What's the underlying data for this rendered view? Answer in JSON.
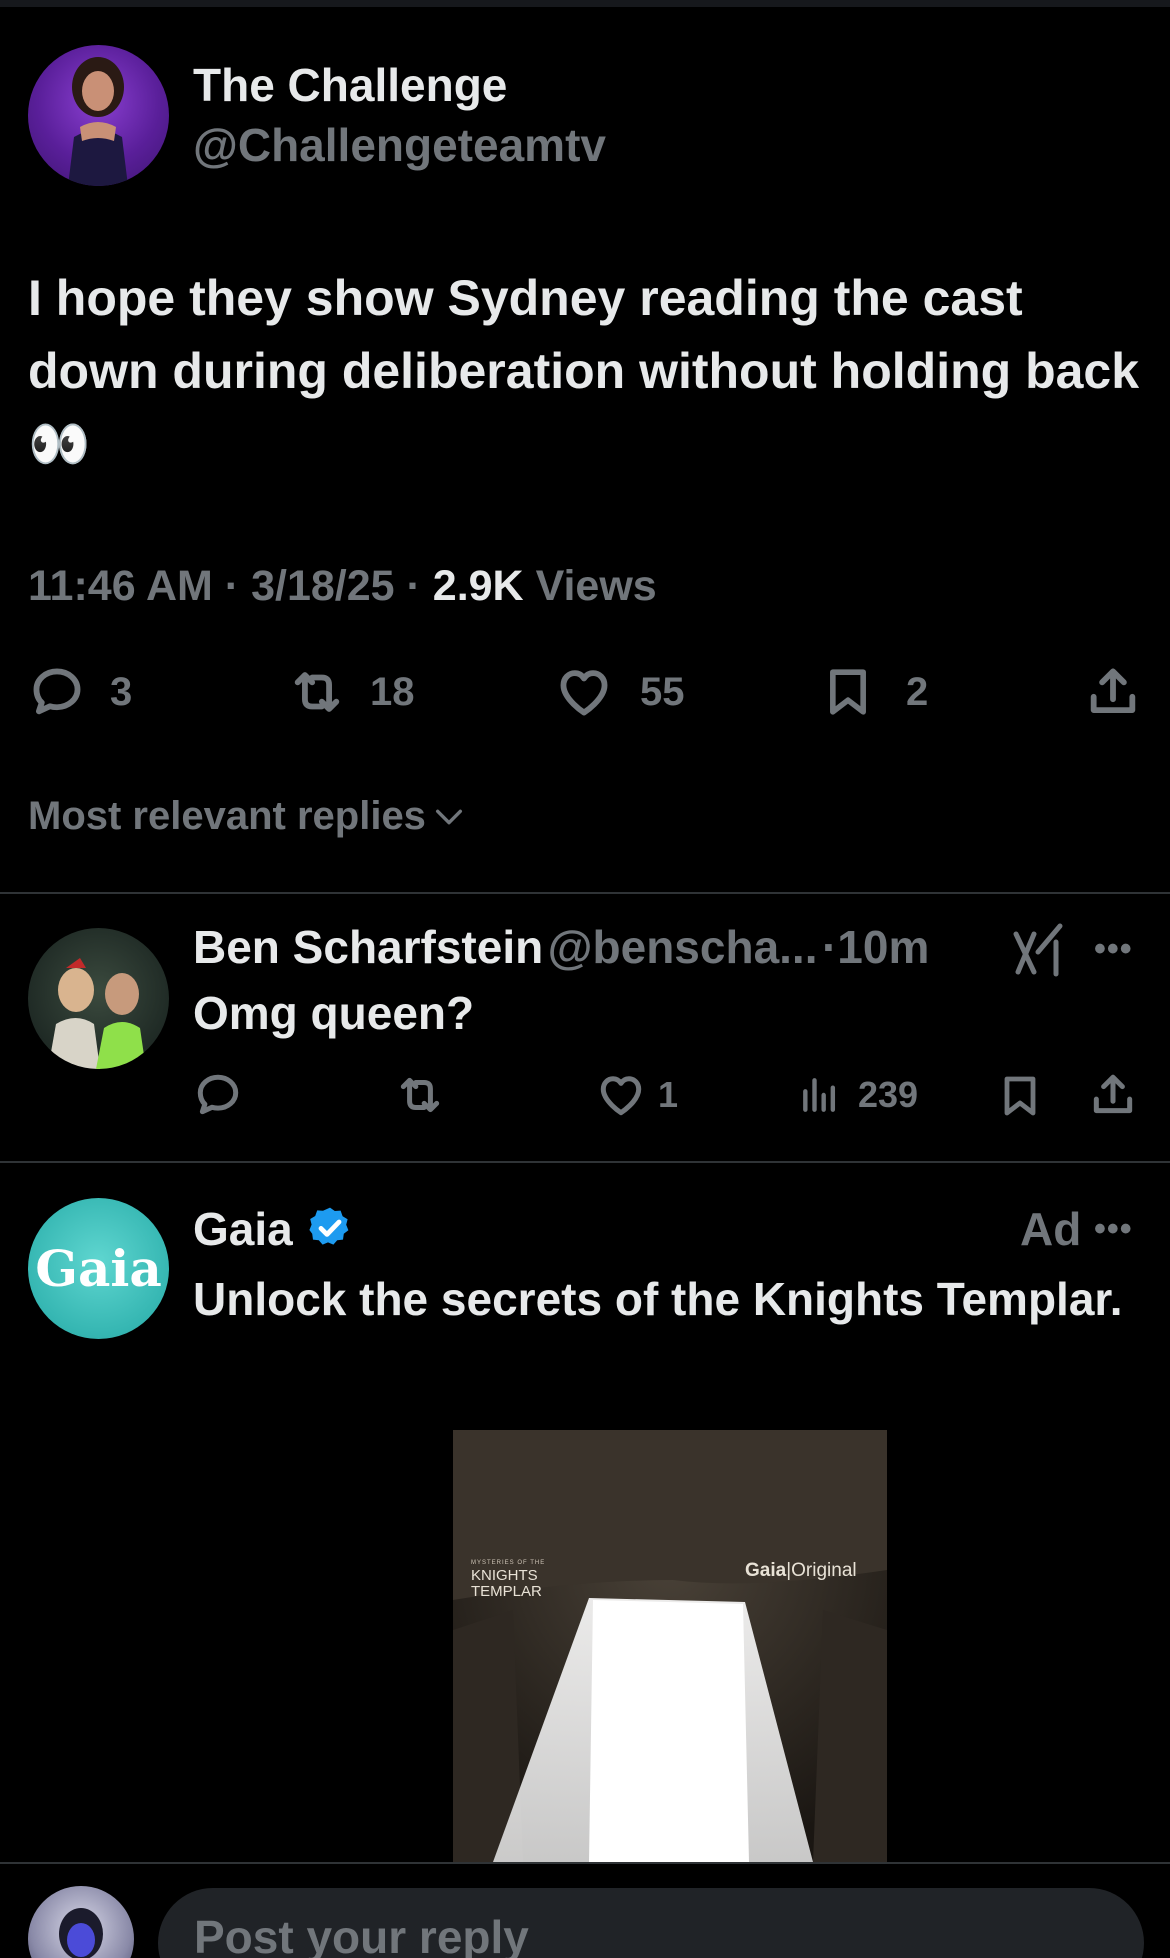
{
  "tweet": {
    "author_name": "The Challenge",
    "author_handle": "@Challengeteamtv",
    "text": "I hope they show Sydney reading  the cast down during deliberation without holding back 👀",
    "time": "11:46 AM",
    "date": "3/18/25",
    "views_count": "2.9K",
    "views_label": "Views",
    "replies": "3",
    "reposts": "18",
    "likes": "55",
    "bookmarks": "2"
  },
  "sort": {
    "label": "Most relevant replies"
  },
  "reply": {
    "author_name": "Ben Scharfstein",
    "author_handle": "@benscha...",
    "time": "10m",
    "text": "Omg queen?",
    "likes": "1",
    "views": "239"
  },
  "ad": {
    "author_name": "Gaia",
    "avatar_text": "Gaia",
    "ad_label": "Ad",
    "text": "Unlock the secrets of the Knights Templar.",
    "image_title_small": "MYSTERIES OF THE",
    "image_title": "KNIGHTS TEMPLAR",
    "image_brand": "Gaia",
    "image_brand_suffix": "Original"
  },
  "composer": {
    "placeholder": "Post your reply"
  },
  "colors": {
    "accent_blue": "#1d9bf0",
    "muted": "#71767b",
    "text": "#e7e9ea",
    "border": "#2f3336",
    "background": "#000000"
  }
}
